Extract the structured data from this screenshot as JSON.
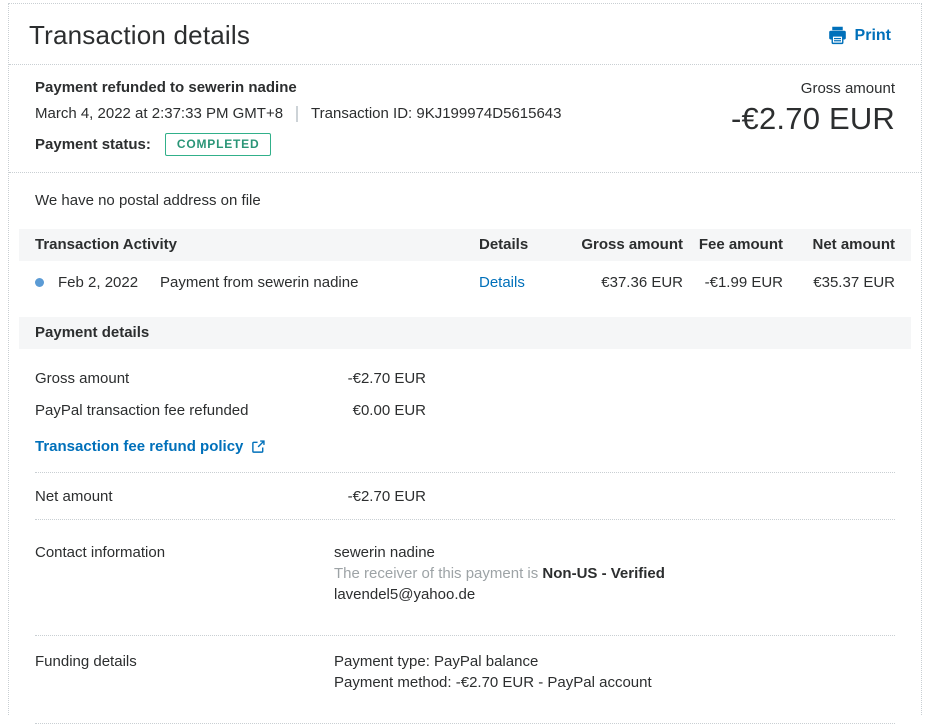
{
  "header": {
    "title": "Transaction details",
    "print_label": "Print"
  },
  "summary": {
    "payment_title": "Payment refunded to sewerin nadine",
    "date": "March 4, 2022 at 2:37:33 PM GMT+8",
    "transaction_id": "Transaction ID: 9KJ199974D5615643",
    "payment_status_label": "Payment status:",
    "payment_status": "COMPLETED",
    "gross_amount_label": "Gross amount",
    "gross_amount": "-€2.70 EUR"
  },
  "postal_note": "We have no postal address on file",
  "activity": {
    "title": "Transaction Activity",
    "columns": [
      "Details",
      "Gross amount",
      "Fee amount",
      "Net amount"
    ],
    "rows": [
      {
        "date": "Feb 2, 2022",
        "description": "Payment from sewerin nadine",
        "details_label": "Details",
        "gross": "€37.36 EUR",
        "fee": "-€1.99 EUR",
        "net": "€35.37 EUR"
      }
    ]
  },
  "payment_details": {
    "title": "Payment details",
    "gross_label": "Gross amount",
    "gross_value": "-€2.70 EUR",
    "fee_label": "PayPal transaction fee refunded",
    "fee_value": "€0.00 EUR",
    "policy_link_label": "Transaction fee refund policy",
    "net_label": "Net amount",
    "net_value": "-€2.70 EUR"
  },
  "contact": {
    "label": "Contact information",
    "name": "sewerin nadine",
    "receiver_note": "The receiver of this payment is ",
    "receiver_status": "Non-US - Verified",
    "email": "lavendel5@yahoo.de"
  },
  "funding": {
    "label": "Funding details",
    "payment_type": "Payment type: PayPal balance",
    "payment_method": "Payment method: -€2.70 EUR - PayPal account"
  },
  "colors": {
    "link_blue": "#0070ba",
    "success_green": "#2a9577",
    "text": "#2c2e2f",
    "band_bg": "#f5f6f7"
  }
}
